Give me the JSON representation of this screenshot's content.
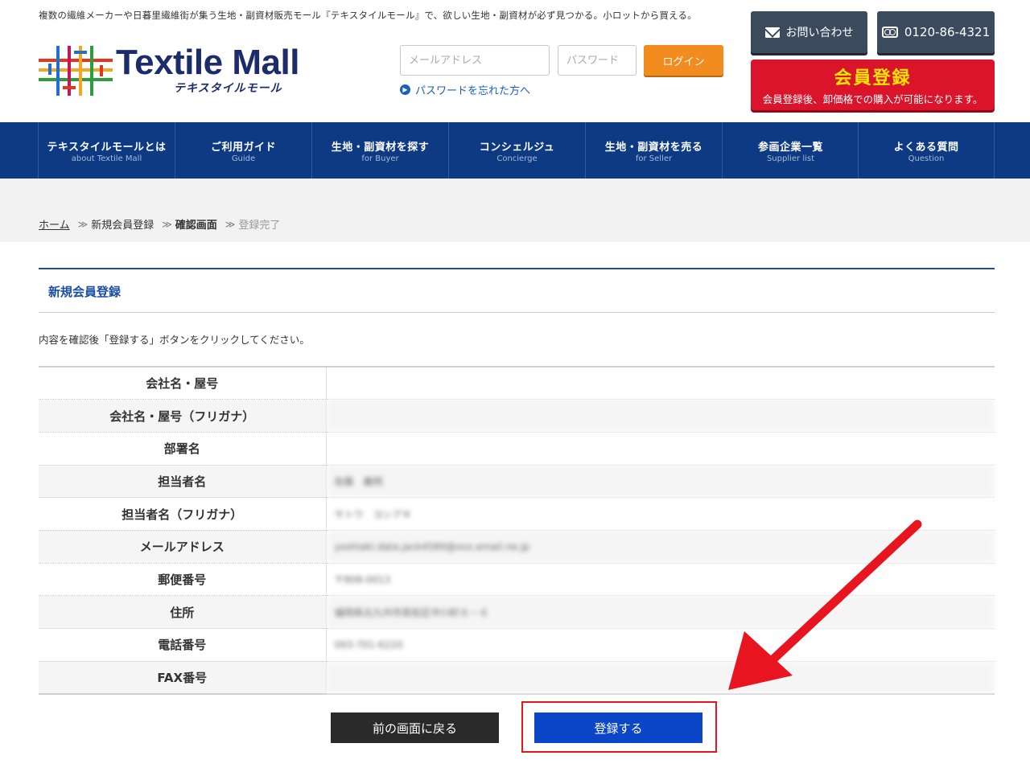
{
  "header": {
    "tagline": "複数の繊維メーカーや日暮里繊維街が集う生地・副資材販売モール『テキスタイルモール』で、欲しい生地・副資材が必ず見つかる。小ロットから買える。",
    "logo_text": "Textile Mall",
    "logo_sub": "テキスタイルモール",
    "email_placeholder": "メールアドレス",
    "password_placeholder": "パスワード",
    "login_label": "ログイン",
    "forgot_label": "パスワードを忘れた方へ",
    "contact_label": "お問い合わせ",
    "phone_label": "0120-86-4321",
    "register_title": "会員登録",
    "register_sub": "会員登録後、卸価格での購入が可能になります。"
  },
  "nav": {
    "items": [
      {
        "label": "テキスタイルモールとは",
        "sub": "about Textile Mall"
      },
      {
        "label": "ご利用ガイド",
        "sub": "Guide"
      },
      {
        "label": "生地・副資材を探す",
        "sub": "for Buyer"
      },
      {
        "label": "コンシェルジュ",
        "sub": "Concierge"
      },
      {
        "label": "生地・副資材を売る",
        "sub": "for Seller"
      },
      {
        "label": "参画企業一覧",
        "sub": "Supplier list"
      },
      {
        "label": "よくある質問",
        "sub": "Question"
      }
    ]
  },
  "breadcrumb": {
    "home": "ホーム",
    "step1": "新規会員登録",
    "step2": "確認画面",
    "step3": "登録完了",
    "separator": "≫"
  },
  "form": {
    "title": "新規会員登録",
    "instruction": "内容を確認後「登録する」ボタンをクリックしてください。",
    "rows": [
      {
        "label": "会社名・屋号",
        "value": ""
      },
      {
        "label": "会社名・屋号（フリガナ）",
        "value": ""
      },
      {
        "label": "部署名",
        "value": ""
      },
      {
        "label": "担当者名",
        "value": "佐藤　義明"
      },
      {
        "label": "担当者名（フリガナ）",
        "value": "サトウ　ヨシアキ"
      },
      {
        "label": "メールアドレス",
        "value": "yoshiaki.data.jack4580@xxx.email.ne.jp"
      },
      {
        "label": "郵便番号",
        "value": "〒808-0013"
      },
      {
        "label": "住所",
        "value": "福岡県北九州市若松区中川町６－６"
      },
      {
        "label": "電話番号",
        "value": "093-701-6220"
      },
      {
        "label": "FAX番号",
        "value": ""
      }
    ]
  },
  "buttons": {
    "back_label": "前の画面に戻る",
    "submit_label": "登録する"
  },
  "colors": {
    "nav_bg": "#0d3a82",
    "accent_orange": "#f28c1e",
    "register_red": "#d9142b",
    "submit_blue": "#0b46c9",
    "annotation_red": "#e8141f"
  },
  "icons": {
    "mail": "mail-icon",
    "phone": "phone-icon",
    "forgot": "circle-arrow-icon"
  }
}
